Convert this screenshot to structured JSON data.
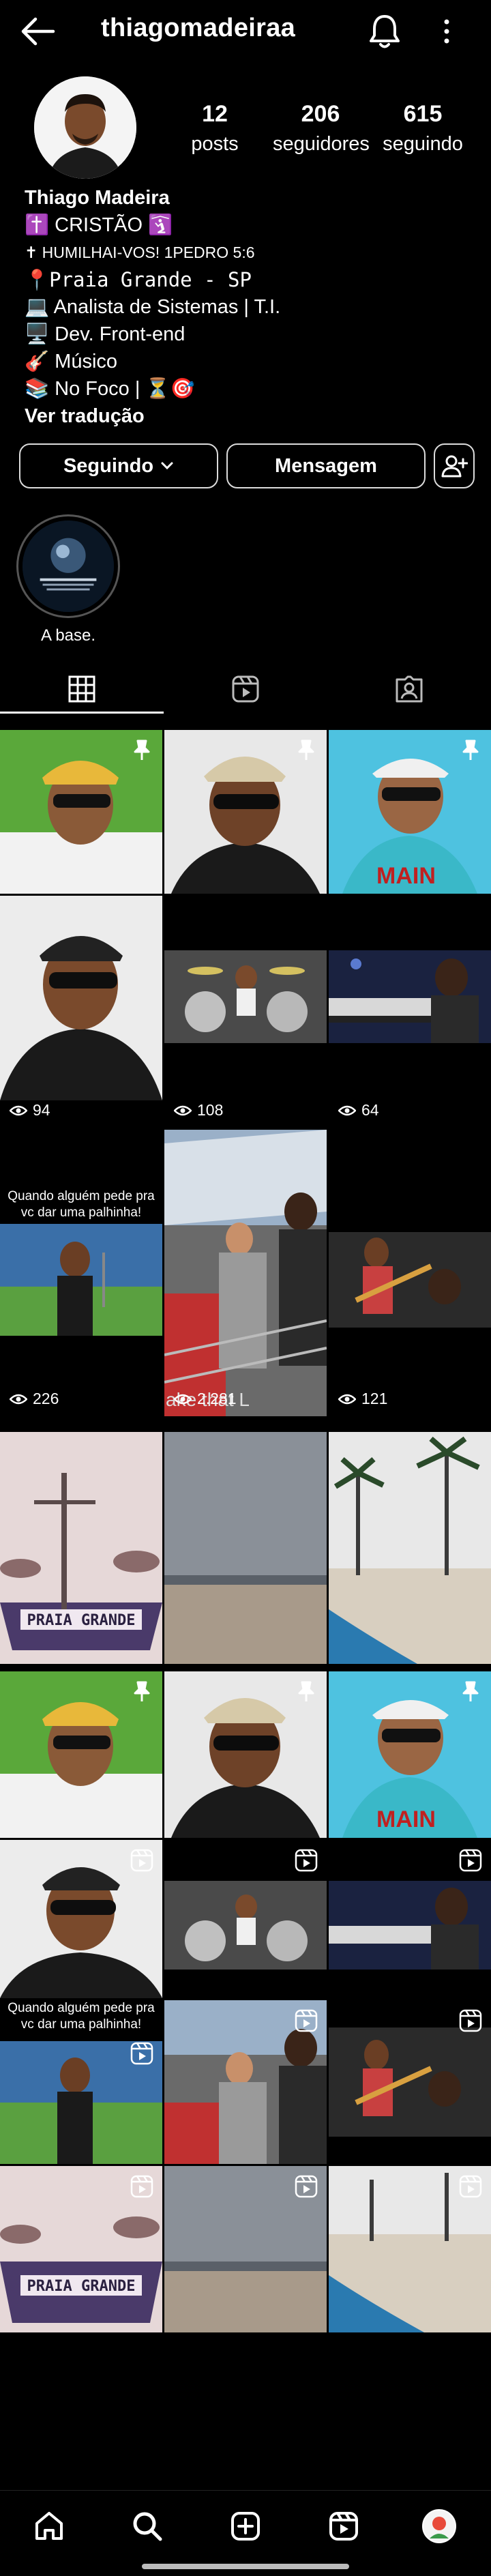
{
  "header": {
    "username": "thiagomadeiraa"
  },
  "stats": [
    {
      "value": "12",
      "label": "posts"
    },
    {
      "value": "206",
      "label": "seguidores"
    },
    {
      "value": "615",
      "label": "seguindo"
    }
  ],
  "bio": {
    "name": "Thiago Madeira",
    "lines": [
      "✝️ CRISTÃO 🛐",
      "✝ HUMILHAI-VOS! 1PEDRO 5:6",
      "📍Praia Grande - SP",
      "💻 Analista de Sistemas | T.I.",
      "🖥️ Dev. Front-end",
      "🎸 Músico",
      "📚 No Foco | ⏳🎯"
    ],
    "translate": "Ver tradução"
  },
  "buttons": {
    "follow": "Seguindo",
    "message": "Mensagem"
  },
  "highlights": [
    {
      "label": "A base."
    }
  ],
  "posts": [
    {
      "views": "94"
    },
    {
      "views": "108"
    },
    {
      "views": "64"
    },
    {
      "views": "226",
      "caption": "Quando alguém pede pra vc dar uma palhinha!"
    },
    {
      "views": "2.281",
      "watermark": "ake that L"
    },
    {
      "views": "121"
    }
  ],
  "reels": [
    {
      "caption": "Quando alguém pede pra vc dar uma palhinha!"
    }
  ],
  "colors": {
    "background": "#000000",
    "text": "#ffffff",
    "border": "#dcdcdc"
  }
}
